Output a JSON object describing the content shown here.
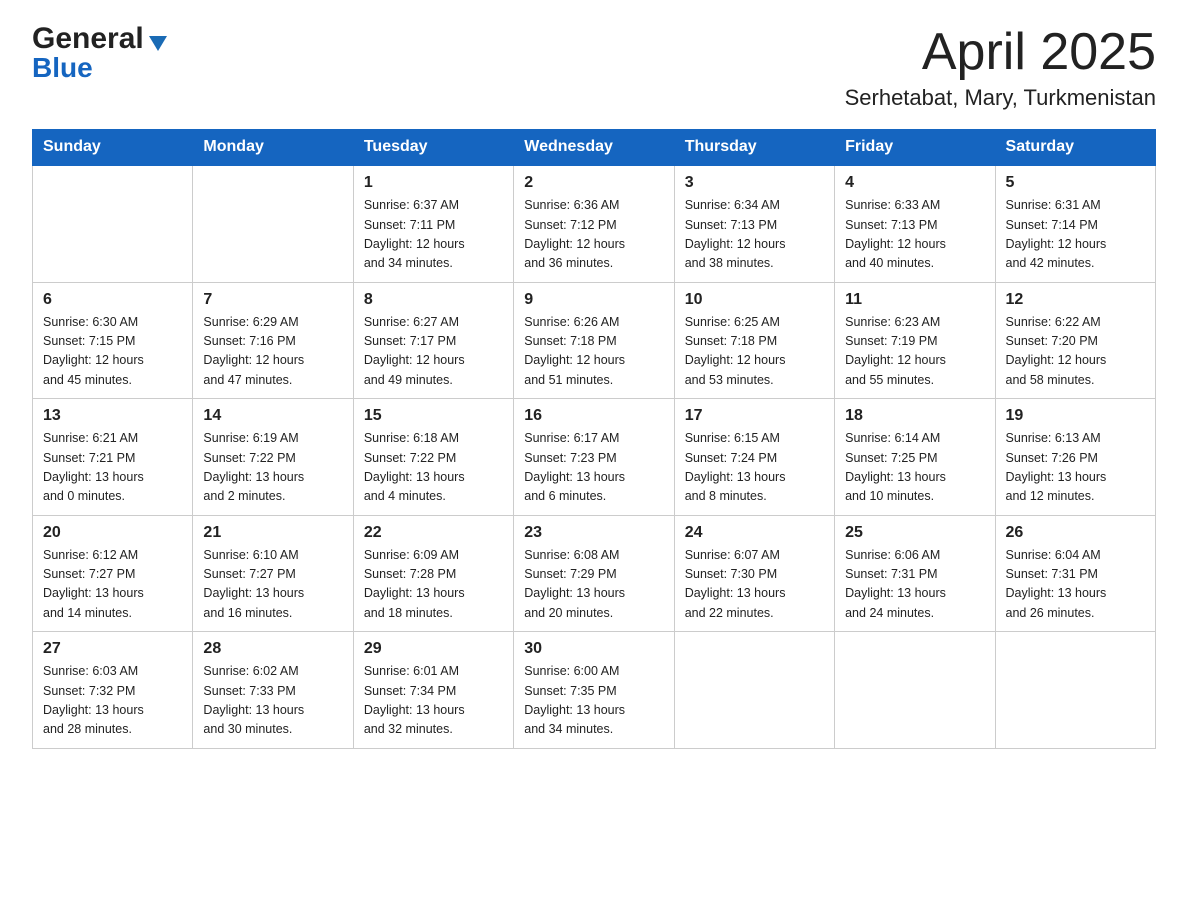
{
  "header": {
    "logo_general": "General",
    "logo_blue": "Blue",
    "title": "April 2025",
    "subtitle": "Serhetabat, Mary, Turkmenistan"
  },
  "calendar": {
    "days_of_week": [
      "Sunday",
      "Monday",
      "Tuesday",
      "Wednesday",
      "Thursday",
      "Friday",
      "Saturday"
    ],
    "weeks": [
      [
        {
          "day": "",
          "info": ""
        },
        {
          "day": "",
          "info": ""
        },
        {
          "day": "1",
          "info": "Sunrise: 6:37 AM\nSunset: 7:11 PM\nDaylight: 12 hours\nand 34 minutes."
        },
        {
          "day": "2",
          "info": "Sunrise: 6:36 AM\nSunset: 7:12 PM\nDaylight: 12 hours\nand 36 minutes."
        },
        {
          "day": "3",
          "info": "Sunrise: 6:34 AM\nSunset: 7:13 PM\nDaylight: 12 hours\nand 38 minutes."
        },
        {
          "day": "4",
          "info": "Sunrise: 6:33 AM\nSunset: 7:13 PM\nDaylight: 12 hours\nand 40 minutes."
        },
        {
          "day": "5",
          "info": "Sunrise: 6:31 AM\nSunset: 7:14 PM\nDaylight: 12 hours\nand 42 minutes."
        }
      ],
      [
        {
          "day": "6",
          "info": "Sunrise: 6:30 AM\nSunset: 7:15 PM\nDaylight: 12 hours\nand 45 minutes."
        },
        {
          "day": "7",
          "info": "Sunrise: 6:29 AM\nSunset: 7:16 PM\nDaylight: 12 hours\nand 47 minutes."
        },
        {
          "day": "8",
          "info": "Sunrise: 6:27 AM\nSunset: 7:17 PM\nDaylight: 12 hours\nand 49 minutes."
        },
        {
          "day": "9",
          "info": "Sunrise: 6:26 AM\nSunset: 7:18 PM\nDaylight: 12 hours\nand 51 minutes."
        },
        {
          "day": "10",
          "info": "Sunrise: 6:25 AM\nSunset: 7:18 PM\nDaylight: 12 hours\nand 53 minutes."
        },
        {
          "day": "11",
          "info": "Sunrise: 6:23 AM\nSunset: 7:19 PM\nDaylight: 12 hours\nand 55 minutes."
        },
        {
          "day": "12",
          "info": "Sunrise: 6:22 AM\nSunset: 7:20 PM\nDaylight: 12 hours\nand 58 minutes."
        }
      ],
      [
        {
          "day": "13",
          "info": "Sunrise: 6:21 AM\nSunset: 7:21 PM\nDaylight: 13 hours\nand 0 minutes."
        },
        {
          "day": "14",
          "info": "Sunrise: 6:19 AM\nSunset: 7:22 PM\nDaylight: 13 hours\nand 2 minutes."
        },
        {
          "day": "15",
          "info": "Sunrise: 6:18 AM\nSunset: 7:22 PM\nDaylight: 13 hours\nand 4 minutes."
        },
        {
          "day": "16",
          "info": "Sunrise: 6:17 AM\nSunset: 7:23 PM\nDaylight: 13 hours\nand 6 minutes."
        },
        {
          "day": "17",
          "info": "Sunrise: 6:15 AM\nSunset: 7:24 PM\nDaylight: 13 hours\nand 8 minutes."
        },
        {
          "day": "18",
          "info": "Sunrise: 6:14 AM\nSunset: 7:25 PM\nDaylight: 13 hours\nand 10 minutes."
        },
        {
          "day": "19",
          "info": "Sunrise: 6:13 AM\nSunset: 7:26 PM\nDaylight: 13 hours\nand 12 minutes."
        }
      ],
      [
        {
          "day": "20",
          "info": "Sunrise: 6:12 AM\nSunset: 7:27 PM\nDaylight: 13 hours\nand 14 minutes."
        },
        {
          "day": "21",
          "info": "Sunrise: 6:10 AM\nSunset: 7:27 PM\nDaylight: 13 hours\nand 16 minutes."
        },
        {
          "day": "22",
          "info": "Sunrise: 6:09 AM\nSunset: 7:28 PM\nDaylight: 13 hours\nand 18 minutes."
        },
        {
          "day": "23",
          "info": "Sunrise: 6:08 AM\nSunset: 7:29 PM\nDaylight: 13 hours\nand 20 minutes."
        },
        {
          "day": "24",
          "info": "Sunrise: 6:07 AM\nSunset: 7:30 PM\nDaylight: 13 hours\nand 22 minutes."
        },
        {
          "day": "25",
          "info": "Sunrise: 6:06 AM\nSunset: 7:31 PM\nDaylight: 13 hours\nand 24 minutes."
        },
        {
          "day": "26",
          "info": "Sunrise: 6:04 AM\nSunset: 7:31 PM\nDaylight: 13 hours\nand 26 minutes."
        }
      ],
      [
        {
          "day": "27",
          "info": "Sunrise: 6:03 AM\nSunset: 7:32 PM\nDaylight: 13 hours\nand 28 minutes."
        },
        {
          "day": "28",
          "info": "Sunrise: 6:02 AM\nSunset: 7:33 PM\nDaylight: 13 hours\nand 30 minutes."
        },
        {
          "day": "29",
          "info": "Sunrise: 6:01 AM\nSunset: 7:34 PM\nDaylight: 13 hours\nand 32 minutes."
        },
        {
          "day": "30",
          "info": "Sunrise: 6:00 AM\nSunset: 7:35 PM\nDaylight: 13 hours\nand 34 minutes."
        },
        {
          "day": "",
          "info": ""
        },
        {
          "day": "",
          "info": ""
        },
        {
          "day": "",
          "info": ""
        }
      ]
    ]
  }
}
